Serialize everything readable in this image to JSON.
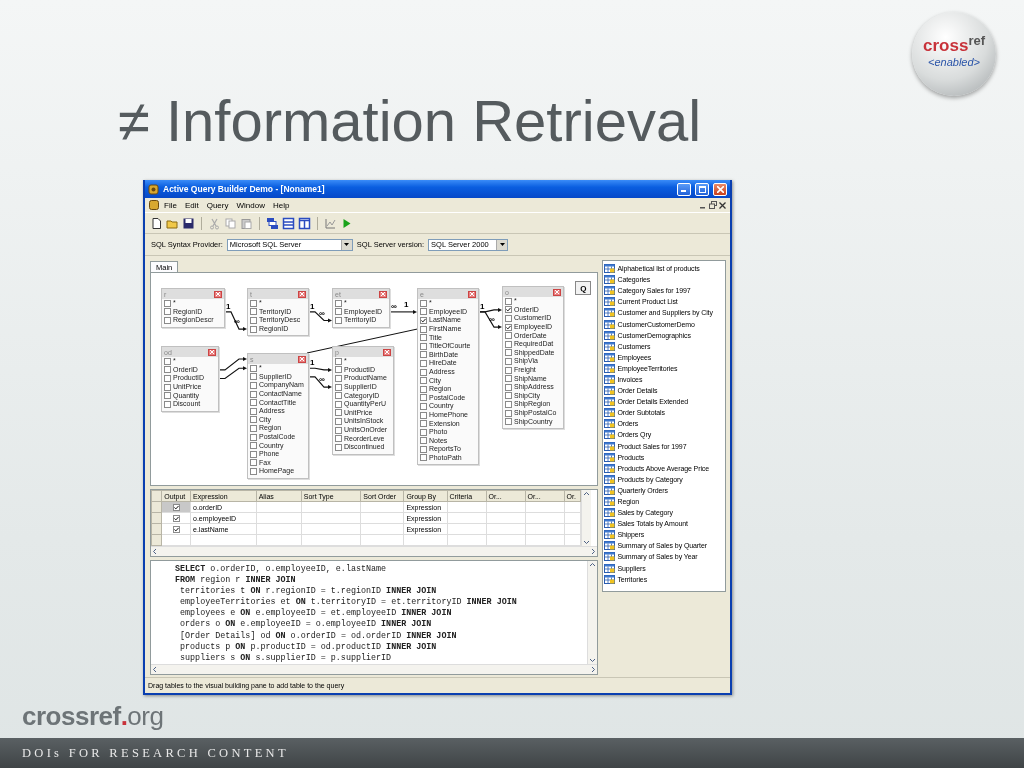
{
  "slide": {
    "title": "≠ Information Retrieval"
  },
  "logo": {
    "word1": "cross",
    "word2": "ref",
    "tagline": "<enabled>"
  },
  "window": {
    "title": "Active Query Builder Demo - [Noname1]"
  },
  "menu": [
    "File",
    "Edit",
    "Query",
    "Window",
    "Help"
  ],
  "provider": {
    "label": "SQL Syntax Provider:",
    "value": "Microsoft SQL Server",
    "version_label": "SQL Server version:",
    "version_value": "SQL Server 2000"
  },
  "tabs": [
    {
      "label": "Main",
      "selected": true
    }
  ],
  "diagram": {
    "query_button": "Q",
    "tables": [
      {
        "alias": "r",
        "fields": [
          {
            "name": "*",
            "checked": false
          },
          {
            "name": "RegionID",
            "checked": false
          },
          {
            "name": "RegionDescr",
            "checked": false
          }
        ]
      },
      {
        "alias": "t",
        "fields": [
          {
            "name": "*",
            "checked": false
          },
          {
            "name": "TerritoryID",
            "checked": false
          },
          {
            "name": "TerritoryDesc",
            "checked": false
          },
          {
            "name": "RegionID",
            "checked": false
          }
        ]
      },
      {
        "alias": "et",
        "fields": [
          {
            "name": "*",
            "checked": false
          },
          {
            "name": "EmployeeID",
            "checked": false
          },
          {
            "name": "TerritoryID",
            "checked": false
          }
        ]
      },
      {
        "alias": "e",
        "fields": [
          {
            "name": "*",
            "checked": false
          },
          {
            "name": "EmployeeID",
            "checked": false
          },
          {
            "name": "LastName",
            "checked": true
          },
          {
            "name": "FirstName",
            "checked": false
          },
          {
            "name": "Title",
            "checked": false
          },
          {
            "name": "TitleOfCourte",
            "checked": false
          },
          {
            "name": "BirthDate",
            "checked": false
          },
          {
            "name": "HireDate",
            "checked": false
          },
          {
            "name": "Address",
            "checked": false
          },
          {
            "name": "City",
            "checked": false
          },
          {
            "name": "Region",
            "checked": false
          },
          {
            "name": "PostalCode",
            "checked": false
          },
          {
            "name": "Country",
            "checked": false
          },
          {
            "name": "HomePhone",
            "checked": false
          },
          {
            "name": "Extension",
            "checked": false
          },
          {
            "name": "Photo",
            "checked": false
          },
          {
            "name": "Notes",
            "checked": false
          },
          {
            "name": "ReportsTo",
            "checked": false
          },
          {
            "name": "PhotoPath",
            "checked": false
          }
        ]
      },
      {
        "alias": "o",
        "fields": [
          {
            "name": "*",
            "checked": false
          },
          {
            "name": "OrderID",
            "checked": true
          },
          {
            "name": "CustomerID",
            "checked": false
          },
          {
            "name": "EmployeeID",
            "checked": true
          },
          {
            "name": "OrderDate",
            "checked": false
          },
          {
            "name": "RequiredDat",
            "checked": false
          },
          {
            "name": "ShippedDate",
            "checked": false
          },
          {
            "name": "ShipVia",
            "checked": false
          },
          {
            "name": "Freight",
            "checked": false
          },
          {
            "name": "ShipName",
            "checked": false
          },
          {
            "name": "ShipAddress",
            "checked": false
          },
          {
            "name": "ShipCity",
            "checked": false
          },
          {
            "name": "ShipRegion",
            "checked": false
          },
          {
            "name": "ShipPostalCo",
            "checked": false
          },
          {
            "name": "ShipCountry",
            "checked": false
          }
        ]
      },
      {
        "alias": "od",
        "fields": [
          {
            "name": "*",
            "checked": false
          },
          {
            "name": "OrderID",
            "checked": false
          },
          {
            "name": "ProductID",
            "checked": false
          },
          {
            "name": "UnitPrice",
            "checked": false
          },
          {
            "name": "Quantity",
            "checked": false
          },
          {
            "name": "Discount",
            "checked": false
          }
        ]
      },
      {
        "alias": "s",
        "fields": [
          {
            "name": "*",
            "checked": false
          },
          {
            "name": "SupplierID",
            "checked": false
          },
          {
            "name": "CompanyNam",
            "checked": false
          },
          {
            "name": "ContactName",
            "checked": false
          },
          {
            "name": "ContactTitle",
            "checked": false
          },
          {
            "name": "Address",
            "checked": false
          },
          {
            "name": "City",
            "checked": false
          },
          {
            "name": "Region",
            "checked": false
          },
          {
            "name": "PostalCode",
            "checked": false
          },
          {
            "name": "Country",
            "checked": false
          },
          {
            "name": "Phone",
            "checked": false
          },
          {
            "name": "Fax",
            "checked": false
          },
          {
            "name": "HomePage",
            "checked": false
          }
        ]
      },
      {
        "alias": "p",
        "fields": [
          {
            "name": "*",
            "checked": false
          },
          {
            "name": "ProductID",
            "checked": false
          },
          {
            "name": "ProductName",
            "checked": false
          },
          {
            "name": "SupplierID",
            "checked": false
          },
          {
            "name": "CategoryID",
            "checked": false
          },
          {
            "name": "QuantityPerU",
            "checked": false
          },
          {
            "name": "UnitPrice",
            "checked": false
          },
          {
            "name": "UnitsInStock",
            "checked": false
          },
          {
            "name": "UnitsOnOrder",
            "checked": false
          },
          {
            "name": "ReorderLeve",
            "checked": false
          },
          {
            "name": "Discontinued",
            "checked": false
          }
        ]
      }
    ],
    "links": [
      {
        "start_label": "1",
        "end_label": "∞"
      },
      {
        "start_label": "1",
        "end_label": "∞"
      },
      {
        "start_label": "∞",
        "end_label": "1"
      },
      {
        "start_label": "1"
      },
      {
        "end_label": "∞"
      },
      {
        "start_label": "1"
      },
      {
        "end_label": "∞"
      }
    ]
  },
  "grid": {
    "columns": [
      "Output",
      "Expression",
      "Alias",
      "Sort Type",
      "Sort Order",
      "Group By",
      "Criteria",
      "Or...",
      "Or...",
      "Or."
    ],
    "rows": [
      {
        "output": true,
        "selected": true,
        "expression": "o.orderID",
        "group_by": "Expression"
      },
      {
        "output": true,
        "selected": false,
        "expression": "o.employeeID",
        "group_by": "Expression"
      },
      {
        "output": true,
        "selected": false,
        "expression": "e.lastName",
        "group_by": "Expression"
      }
    ]
  },
  "sql": [
    "**SELECT** o.orderID, o.employeeID, e.lastName",
    "**FROM** region r **INNER JOIN**",
    " territories t **ON** r.regionID = t.regionID **INNER JOIN**",
    " employeeTerritories et **ON** t.territoryID = et.territoryID **INNER JOIN**",
    " employees e **ON** e.employeeID = et.employeeID **INNER JOIN**",
    " orders o **ON** e.employeeID = o.employeeID **INNER JOIN**",
    " [Order Details] od **ON** o.orderID = od.orderID **INNER JOIN**",
    " products p **ON** p.productID = od.productID **INNER JOIN**",
    " suppliers s **ON** s.supplierID = p.supplierID"
  ],
  "objects": [
    "Alphabetical list of products",
    "Categories",
    "Category Sales for 1997",
    "Current Product List",
    "Customer and Suppliers by City",
    "CustomerCustomerDemo",
    "CustomerDemographics",
    "Customers",
    "Employees",
    "EmployeeTerritories",
    "Invoices",
    "Order Details",
    "Order Details Extended",
    "Order Subtotals",
    "Orders",
    "Orders Qry",
    "Product Sales for 1997",
    "Products",
    "Products Above Average Price",
    "Products by Category",
    "Quarterly Orders",
    "Region",
    "Sales by Category",
    "Sales Totals by Amount",
    "Shippers",
    "Summary of Sales by Quarter",
    "Summary of Sales by Year",
    "Suppliers",
    "Territories"
  ],
  "status_bar": "Drag tables to the visual building pane to add table to the query",
  "footer": {
    "site_name": "crossref",
    "site_dot": ".",
    "site_tld": "org",
    "tagline": "DOIs FOR RESEARCH CONTENT"
  }
}
